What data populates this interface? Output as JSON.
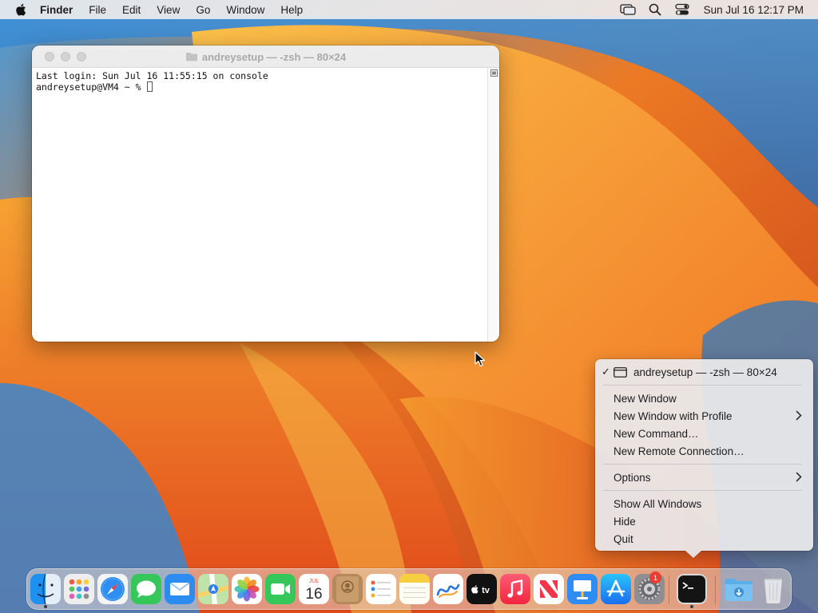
{
  "menubar": {
    "app_name": "Finder",
    "items": [
      "File",
      "Edit",
      "View",
      "Go",
      "Window",
      "Help"
    ],
    "clock": "Sun Jul 16  12:17 PM",
    "status_icons": [
      "screen-mirroring-icon",
      "spotlight-search-icon",
      "control-center-icon"
    ]
  },
  "terminal": {
    "title": "andreysetup — -zsh — 80×24",
    "lines": [
      "Last login: Sun Jul 16 11:55:15 on console",
      "andreysetup@VM4 ~ % "
    ]
  },
  "dock_menu": {
    "window_entry": "andreysetup — -zsh — 80×24",
    "items": [
      "New Window",
      "New Window with Profile",
      "New Command…",
      "New Remote Connection…",
      "Options",
      "Show All Windows",
      "Hide",
      "Quit"
    ]
  },
  "dock": {
    "apps": [
      "finder-icon",
      "launchpad-icon",
      "safari-icon",
      "messages-icon",
      "mail-icon",
      "maps-icon",
      "photos-icon",
      "facetime-icon",
      "calendar-icon",
      "contacts-icon",
      "reminders-icon",
      "notes-icon",
      "freeform-icon",
      "apple-tv-icon",
      "music-icon",
      "news-icon",
      "keynote-icon",
      "app-store-icon",
      "system-settings-icon",
      "terminal-icon",
      "downloads-folder-icon",
      "trash-icon"
    ],
    "calendar_month": "JUL",
    "calendar_day": "16",
    "settings_badge": "1",
    "tv_label": "tv"
  },
  "colors": {
    "menu_bar": "#ececee",
    "wallpaper_orange": "#f08a24",
    "wallpaper_red": "#d8401c",
    "wallpaper_blue": "#3a7fc4"
  }
}
